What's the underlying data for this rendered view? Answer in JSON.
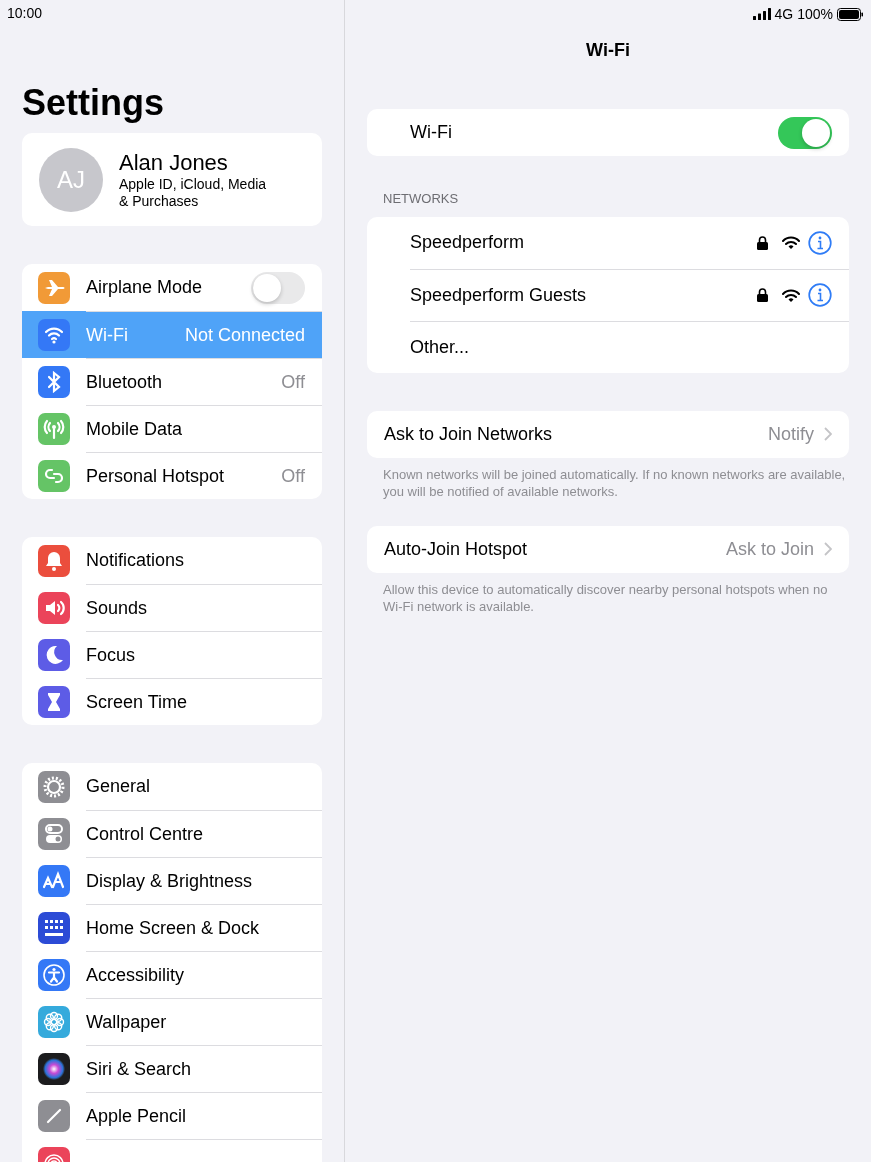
{
  "status_bar": {
    "time": "10:00",
    "network": "4G",
    "battery": "100%"
  },
  "sidebar": {
    "title": "Settings",
    "profile": {
      "initials": "AJ",
      "name": "Alan Jones",
      "subtitle": "Apple ID, iCloud, Media & Purchases"
    },
    "groups": [
      [
        {
          "kind": "toggle",
          "label": "Airplane Mode",
          "on": false,
          "selected": false
        },
        {
          "kind": "link",
          "label": "Wi-Fi",
          "value": "Not Connected",
          "selected": true
        },
        {
          "kind": "link",
          "label": "Bluetooth",
          "value": "Off",
          "selected": false
        },
        {
          "kind": "link",
          "label": "Mobile Data",
          "selected": false
        },
        {
          "kind": "link",
          "label": "Personal Hotspot",
          "value": "Off",
          "selected": false
        }
      ],
      [
        {
          "kind": "link",
          "label": "Notifications",
          "selected": false
        },
        {
          "kind": "link",
          "label": "Sounds",
          "selected": false
        },
        {
          "kind": "link",
          "label": "Focus",
          "selected": false
        },
        {
          "kind": "link",
          "label": "Screen Time",
          "selected": false
        }
      ],
      [
        {
          "kind": "link",
          "label": "General",
          "selected": false
        },
        {
          "kind": "link",
          "label": "Control Centre",
          "selected": false
        },
        {
          "kind": "link",
          "label": "Display & Brightness",
          "selected": false
        },
        {
          "kind": "link",
          "label": "Home Screen & Dock",
          "selected": false
        },
        {
          "kind": "link",
          "label": "Accessibility",
          "selected": false
        },
        {
          "kind": "link",
          "label": "Wallpaper",
          "selected": false
        },
        {
          "kind": "link",
          "label": "Siri & Search",
          "selected": false
        },
        {
          "kind": "link",
          "label": "Apple Pencil",
          "selected": false
        },
        {
          "kind": "link",
          "selected": false
        }
      ]
    ]
  },
  "detail": {
    "title": "Wi-Fi",
    "wifi_toggle": {
      "label": "Wi-Fi",
      "on": true
    },
    "networks_header": "NETWORKS",
    "networks": [
      {
        "name": "Speedperform",
        "secured": true
      },
      {
        "name": "Speedperform Guests",
        "secured": true
      }
    ],
    "other": "Other...",
    "options": [
      {
        "label": "Ask to Join Networks",
        "value": "Notify",
        "footer": "Known networks will be joined automatically. If no known networks are available, you will be notified of available networks."
      },
      {
        "label": "Auto-Join Hotspot",
        "value": "Ask to Join",
        "footer": "Allow this device to automatically discover nearby personal hotspots when no Wi-Fi network is available."
      }
    ]
  }
}
